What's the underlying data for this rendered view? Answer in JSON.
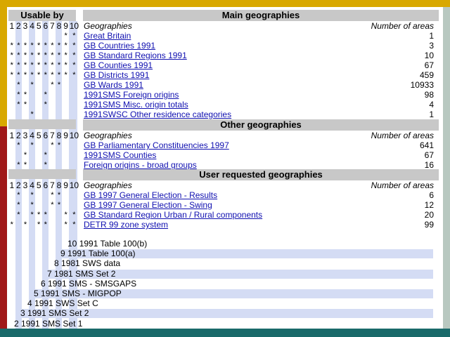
{
  "usable_header": "Usable by",
  "col_numbers": [
    "1",
    "2",
    "3",
    "4",
    "5",
    "6",
    "7",
    "8",
    "9",
    "10"
  ],
  "col_header": "Geographies",
  "areas_header": "Number of areas",
  "sections": [
    {
      "title": "Main geographies",
      "rows": [
        {
          "name": "Great Britain",
          "n": "1",
          "u": [
            9,
            10
          ]
        },
        {
          "name": "GB Countries 1991",
          "n": "3",
          "u": [
            1,
            2,
            3,
            4,
            5,
            6,
            7,
            8,
            9,
            10
          ]
        },
        {
          "name": "GB Standard Regions 1991",
          "n": "10",
          "u": [
            1,
            2,
            3,
            4,
            5,
            6,
            7,
            8,
            9,
            10
          ]
        },
        {
          "name": "GB Counties 1991",
          "n": "67",
          "u": [
            1,
            2,
            3,
            4,
            5,
            6,
            7,
            8,
            9,
            10
          ]
        },
        {
          "name": "GB Districts 1991",
          "n": "459",
          "u": [
            1,
            2,
            3,
            4,
            5,
            6,
            7,
            8,
            9,
            10
          ]
        },
        {
          "name": "GB Wards 1991",
          "n": "10933",
          "u": [
            2,
            4,
            7,
            8
          ]
        },
        {
          "name": "1991SMS Foreign origins",
          "n": "98",
          "u": [
            2,
            3,
            6
          ]
        },
        {
          "name": "1991SMS Misc. origin totals",
          "n": "4",
          "u": [
            2,
            3,
            6
          ]
        },
        {
          "name": "1991SWSC Other residence categories",
          "n": "1",
          "u": [
            4
          ]
        }
      ]
    },
    {
      "title": "Other geographies",
      "rows": [
        {
          "name": "GB Parliamentary Constituencies 1997",
          "n": "641",
          "u": [
            2,
            4,
            7,
            8
          ]
        },
        {
          "name": "1991SMS Counties",
          "n": "67",
          "u": [
            3,
            6
          ]
        },
        {
          "name": "Foreign origins - broad groups",
          "n": "16",
          "u": [
            2,
            3,
            6
          ]
        }
      ]
    },
    {
      "title": "User requested geographies",
      "rows": [
        {
          "name": "GB 1997 General Election - Results",
          "n": "6",
          "u": [
            2,
            4,
            7,
            8
          ]
        },
        {
          "name": "GB 1997 General Election - Swing",
          "n": "12",
          "u": [
            2,
            4,
            7,
            8
          ]
        },
        {
          "name": "GB Standard Region Urban / Rural components",
          "n": "20",
          "u": [
            2,
            4,
            5,
            6,
            9,
            10
          ]
        },
        {
          "name": "DETR 99 zone system",
          "n": "99",
          "u": [
            1,
            3,
            5,
            6,
            9,
            10
          ]
        }
      ]
    }
  ],
  "datasets": [
    {
      "num": "10",
      "label": "1991 Table 100(b)"
    },
    {
      "num": "9",
      "label": "1991 Table 100(a)"
    },
    {
      "num": "8",
      "label": "1981 SWS data"
    },
    {
      "num": "7",
      "label": "1981 SMS Set 2"
    },
    {
      "num": "6",
      "label": "1991 SMS - SMSGAPS"
    },
    {
      "num": "5",
      "label": "1991 SMS - MIGPOP"
    },
    {
      "num": "4",
      "label": "1991 SWS Set C"
    },
    {
      "num": "3",
      "label": "1991 SMS Set 2"
    },
    {
      "num": "2",
      "label": "1991 SMS Set 1"
    }
  ],
  "colors": {
    "link": "#1010b0",
    "stripe": "#d4dcf4",
    "header": "#c8c8c8"
  }
}
